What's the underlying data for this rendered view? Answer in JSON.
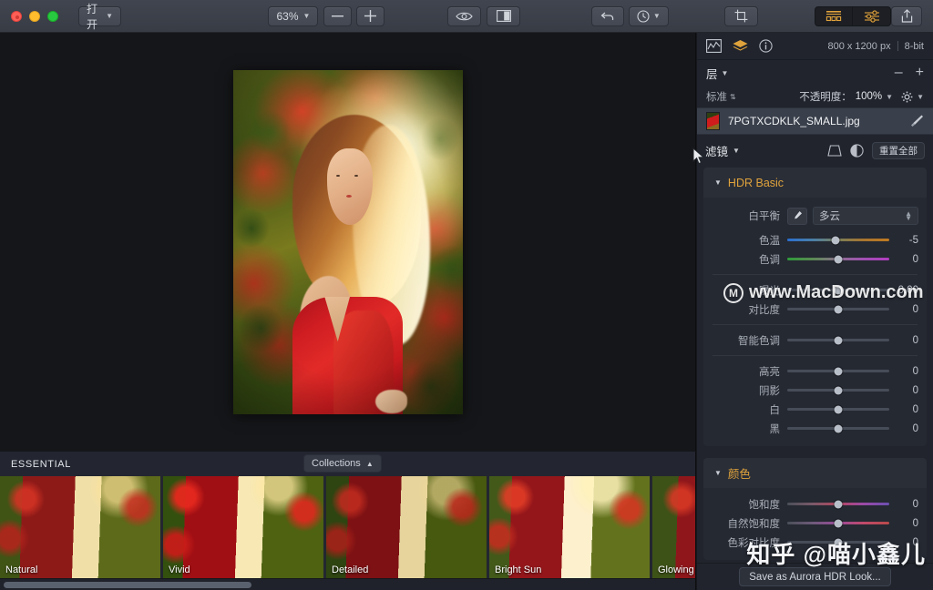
{
  "toolbar": {
    "open_label": "打开",
    "zoom_value": "63%",
    "zoom_out": "–",
    "zoom_in": "+",
    "preview_icon": "eye-icon",
    "compare_icon": "split-view-icon",
    "undo_icon": "undo-arrow-icon",
    "history_icon": "history-clock-icon",
    "crop_icon": "crop-icon",
    "presets_toggle_icon": "presets-panel-icon",
    "adjust_toggle_icon": "adjustments-panel-icon",
    "share_icon": "share-icon"
  },
  "panel": {
    "histogram_icon": "histogram-icon",
    "layers_icon": "layers-icon",
    "info_icon": "info-icon",
    "image_size": "800 x 1200 px",
    "bit_depth": "8-bit",
    "layers_title": "层",
    "remove_layer": "–",
    "add_layer": "+",
    "blend_mode": "标准",
    "opacity_label": "不透明度：",
    "opacity_value": "100%",
    "gear_icon": "gear-icon",
    "layer": {
      "name": "7PGTXCDKLK_SMALL.jpg",
      "brush_icon": "brush-icon"
    },
    "filters_title": "滤镜",
    "transform_icon": "transform-icon",
    "mask_icon": "mask-icon",
    "reset_all": "重置全部"
  },
  "hdr_basic": {
    "title": "HDR Basic",
    "white_balance_label": "白平衡",
    "eyedropper_icon": "eyedropper-icon",
    "white_balance_value": "多云",
    "sliders": [
      {
        "label": "色温",
        "value": "-5",
        "pos": 47,
        "style": "temp"
      },
      {
        "label": "色调",
        "value": "0",
        "pos": 50,
        "style": "tint"
      },
      {
        "label": "曝光",
        "value": "0.00",
        "pos": 50,
        "style": ""
      },
      {
        "label": "对比度",
        "value": "0",
        "pos": 50,
        "style": ""
      }
    ],
    "sliders2": [
      {
        "label": "智能色调",
        "value": "0",
        "pos": 50,
        "style": ""
      }
    ],
    "sliders3": [
      {
        "label": "高亮",
        "value": "0",
        "pos": 50,
        "style": ""
      },
      {
        "label": "阴影",
        "value": "0",
        "pos": 50,
        "style": ""
      },
      {
        "label": "白",
        "value": "0",
        "pos": 50,
        "style": ""
      },
      {
        "label": "黑",
        "value": "0",
        "pos": 50,
        "style": ""
      }
    ]
  },
  "color_section": {
    "title": "颜色",
    "sliders": [
      {
        "label": "饱和度",
        "value": "0",
        "pos": 50,
        "style": "sat"
      },
      {
        "label": "自然饱和度",
        "value": "0",
        "pos": 50,
        "style": "vib"
      },
      {
        "label": "色彩对比度",
        "value": "0",
        "pos": 50,
        "style": ""
      }
    ]
  },
  "save_look_label": "Save as Aurora HDR Look...",
  "presets": {
    "category": "ESSENTIAL",
    "collections_label": "Collections",
    "items": [
      {
        "label": "Natural"
      },
      {
        "label": "Vivid"
      },
      {
        "label": "Detailed"
      },
      {
        "label": "Bright Sun"
      },
      {
        "label": "Glowing"
      }
    ]
  },
  "watermarks": {
    "macdown": "www.MacDown.com",
    "macdown_mark": "M",
    "zhihu": "知乎 @喵小鑫儿"
  },
  "colors": {
    "accent": "#e0a33c",
    "panel_bg": "#21242c",
    "canvas_bg": "#151619"
  }
}
